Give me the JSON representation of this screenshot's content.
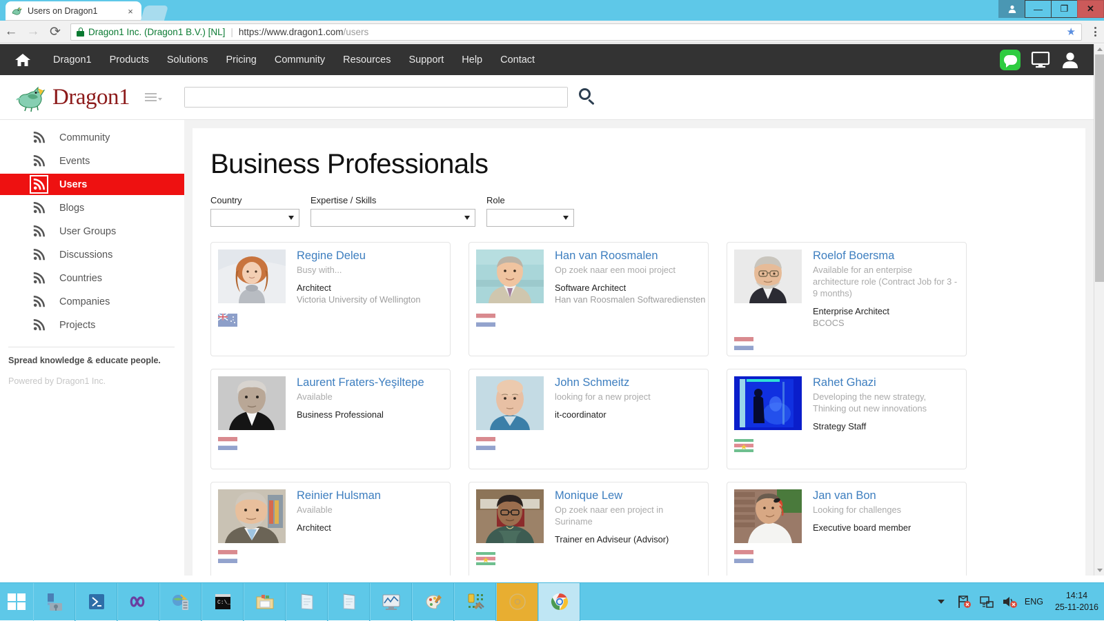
{
  "browser": {
    "tab_title": "Users on Dragon1",
    "tab_close_label": "×",
    "favicon_name": "dragon-favicon",
    "new_tab_label": "",
    "back_label": "←",
    "forward_label": "→",
    "reload_label": "⟳",
    "site_identity": "Dragon1 Inc. (Dragon1 B.V.) [NL]",
    "url_main": "https://www.dragon1.com",
    "url_path": "/users",
    "star_label": "★",
    "window_buttons": {
      "user": "●",
      "minimize": "—",
      "restore": "❐",
      "close": "✕"
    }
  },
  "topnav": {
    "home_icon": "home-icon",
    "items": [
      {
        "label": "Dragon1"
      },
      {
        "label": "Products"
      },
      {
        "label": "Solutions"
      },
      {
        "label": "Pricing"
      },
      {
        "label": "Community"
      },
      {
        "label": "Resources"
      },
      {
        "label": "Support"
      },
      {
        "label": "Help"
      },
      {
        "label": "Contact"
      }
    ],
    "right_icons": [
      "chat-icon",
      "monitor-icon",
      "user-account-icon"
    ]
  },
  "brand": {
    "logo_text": "Dragon1",
    "logo_color": "#8d1b1b",
    "menu_icon": "hamburger-menu-icon",
    "search_placeholder": "",
    "search_value": "",
    "search_icon": "search-icon"
  },
  "sidebar": {
    "items": [
      {
        "label": "Community",
        "active": false
      },
      {
        "label": "Events",
        "active": false
      },
      {
        "label": "Users",
        "active": true
      },
      {
        "label": "Blogs",
        "active": false
      },
      {
        "label": "User Groups",
        "active": false
      },
      {
        "label": "Discussions",
        "active": false
      },
      {
        "label": "Countries",
        "active": false
      },
      {
        "label": "Companies",
        "active": false
      },
      {
        "label": "Projects",
        "active": false
      }
    ],
    "tagline": "Spread knowledge & educate people.",
    "powered_by": "Powered by Dragon1 Inc.",
    "active_color": "#ee1111"
  },
  "main": {
    "title": "Business Professionals",
    "filters": [
      {
        "label": "Country",
        "value": ""
      },
      {
        "label": "Expertise / Skills",
        "value": ""
      },
      {
        "label": "Role",
        "value": ""
      }
    ],
    "users": [
      {
        "name": "Regine Deleu",
        "status": "Busy with...",
        "role": "Architect",
        "company": "Victoria University of Wellington",
        "flag": "new-zealand",
        "avatar": "photo-regine-deleu"
      },
      {
        "name": "Han van Roosmalen",
        "status": "Op zoek naar een mooi project",
        "role": "Software Architect",
        "company": "Han van Roosmalen Softwarediensten",
        "flag": "netherlands",
        "avatar": "photo-han-van-roosmalen"
      },
      {
        "name": "Roelof Boersma",
        "status": "Available for an enterpise architecture role (Contract Job for 3 - 9 months)",
        "role": "Enterprise Architect",
        "company": "BCOCS",
        "flag": "netherlands",
        "avatar": "photo-roelof-boersma"
      },
      {
        "name": "Laurent Fraters-Yeşiltepe",
        "status": "Available",
        "role": "Business Professional",
        "company": "",
        "flag": "netherlands",
        "avatar": "photo-laurent-fraters"
      },
      {
        "name": "John Schmeitz",
        "status": "looking for a new project",
        "role": "it-coordinator",
        "company": "",
        "flag": "netherlands",
        "avatar": "photo-john-schmeitz"
      },
      {
        "name": "Rahet Ghazi",
        "status": "Developing the new strategy, Thinking out new innovations",
        "role": "Strategy Staff",
        "company": "",
        "flag": "suriname",
        "avatar": "photo-rahet-ghazi"
      },
      {
        "name": "Reinier Hulsman",
        "status": "Available",
        "role": "Architect",
        "company": "",
        "flag": "netherlands",
        "avatar": "photo-reinier-hulsman"
      },
      {
        "name": "Monique Lew",
        "status": "Op zoek naar een project in Suriname",
        "role": "Trainer en Adviseur (Advisor)",
        "company": "",
        "flag": "suriname",
        "avatar": "photo-monique-lew"
      },
      {
        "name": "Jan van Bon",
        "status": "Looking for challenges",
        "role": "Executive board member",
        "company": "",
        "flag": "netherlands",
        "avatar": "photo-jan-van-bon"
      }
    ]
  },
  "taskbar": {
    "start_label": "start-button",
    "items": [
      "server-manager-icon",
      "powershell-icon",
      "visual-studio-icon",
      "iis-manager-icon",
      "command-prompt-icon",
      "file-explorer-icon",
      "notepad-icon",
      "notepad-icon",
      "performance-monitor-icon",
      "paint-icon",
      "tools-icon",
      "media-icon",
      "chrome-icon"
    ],
    "tray": {
      "show_hidden": "show-hidden-icons",
      "network_flag": "network-flag-icon",
      "network": "network-icon",
      "volume": "volume-muted-icon",
      "language": "ENG",
      "time": "14:14",
      "date": "25-11-2016"
    }
  }
}
